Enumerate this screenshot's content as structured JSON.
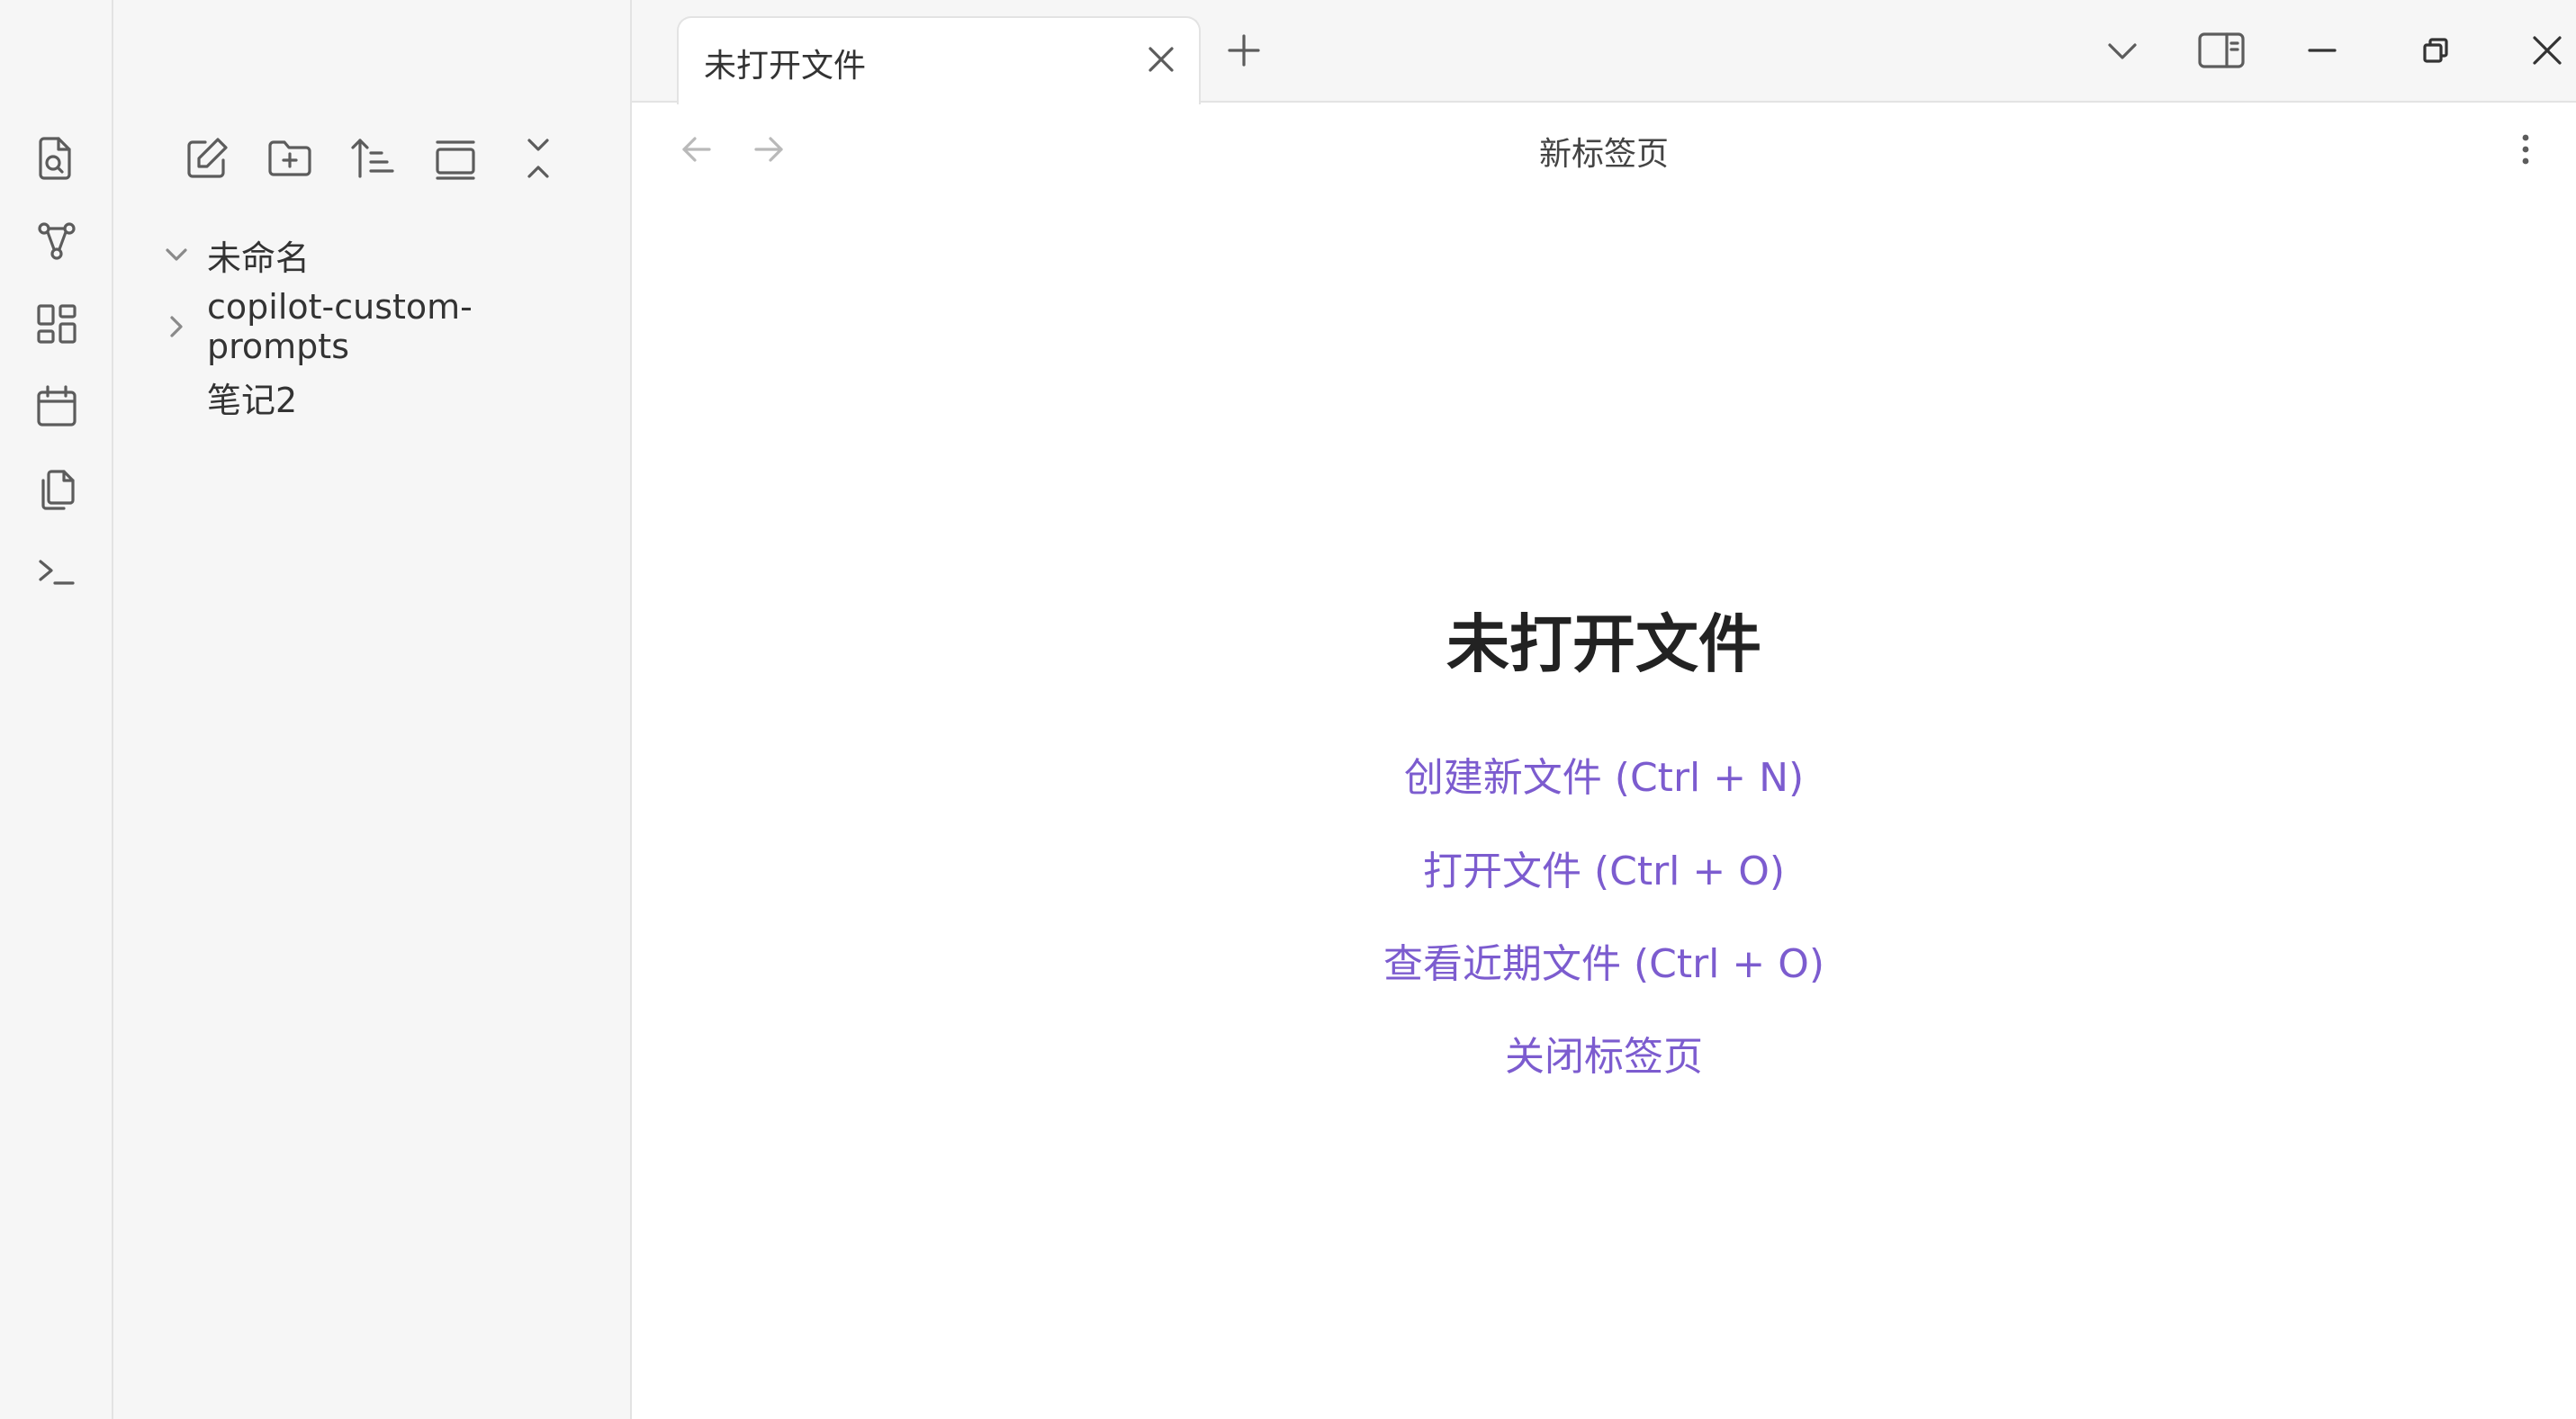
{
  "tabs": [
    {
      "label": "未打开文件"
    }
  ],
  "view": {
    "title": "新标签页"
  },
  "file_tree": {
    "root": "未命名",
    "items": [
      {
        "label": "copilot-custom-prompts",
        "type": "folder"
      },
      {
        "label": "笔记2",
        "type": "file"
      }
    ]
  },
  "empty_state": {
    "title": "未打开文件",
    "actions": [
      "创建新文件 (Ctrl + N)",
      "打开文件 (Ctrl + O)",
      "查看近期文件 (Ctrl + O)",
      "关闭标签页"
    ]
  },
  "colors": {
    "accent": "#7c5ccf",
    "panel": "#f6f6f6",
    "border": "#e3e3e3"
  }
}
